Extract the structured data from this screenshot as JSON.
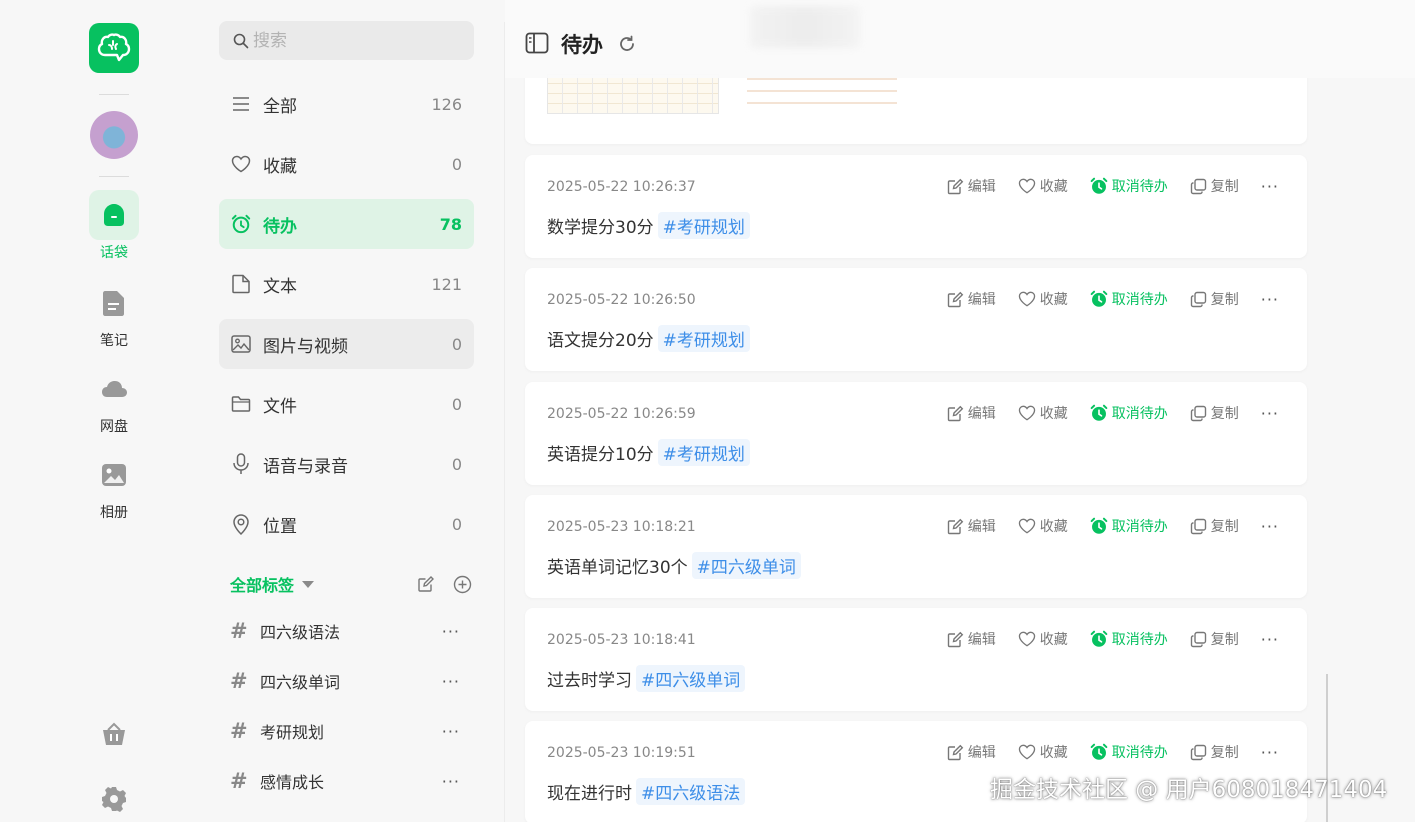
{
  "rail": {
    "items": [
      {
        "label": "话袋",
        "icon": "home-bag-icon",
        "active": true
      },
      {
        "label": "笔记",
        "icon": "note-icon"
      },
      {
        "label": "网盘",
        "icon": "cloud-icon"
      },
      {
        "label": "相册",
        "icon": "album-icon"
      }
    ]
  },
  "search": {
    "placeholder": "搜索"
  },
  "categories": [
    {
      "label": "全部",
      "count": "126"
    },
    {
      "label": "收藏",
      "count": "0"
    },
    {
      "label": "待办",
      "count": "78"
    },
    {
      "label": "文本",
      "count": "121"
    },
    {
      "label": "图片与视频",
      "count": "0"
    },
    {
      "label": "文件",
      "count": "0"
    },
    {
      "label": "语音与录音",
      "count": "0"
    },
    {
      "label": "位置",
      "count": "0"
    }
  ],
  "tags": {
    "header": "全部标签",
    "items": [
      "四六级语法",
      "四六级单词",
      "考研规划",
      "感情成长"
    ],
    "more": "···"
  },
  "header": {
    "title": "待办"
  },
  "actions": {
    "edit": "编辑",
    "favorite": "收藏",
    "cancel_todo": "取消待办",
    "copy": "复制",
    "more": "···"
  },
  "notes": [
    {
      "time": "2025-05-22 10:26:37",
      "text": "数学提分30分",
      "tag": "#考研规划"
    },
    {
      "time": "2025-05-22 10:26:50",
      "text": "语文提分20分",
      "tag": "#考研规划"
    },
    {
      "time": "2025-05-22 10:26:59",
      "text": "英语提分10分",
      "tag": "#考研规划"
    },
    {
      "time": "2025-05-23 10:18:21",
      "text": "英语单词记忆30个",
      "tag": "#四六级单词"
    },
    {
      "time": "2025-05-23 10:18:41",
      "text": "过去时学习",
      "tag": "#四六级单词"
    },
    {
      "time": "2025-05-23 10:19:51",
      "text": "现在进行时",
      "tag": "#四六级语法"
    }
  ],
  "watermark": "掘金技术社区 @ 用户608018471404",
  "colors": {
    "accent": "#07c160",
    "tag": "#3d8ee8",
    "active_bg": "#dff3e6"
  }
}
